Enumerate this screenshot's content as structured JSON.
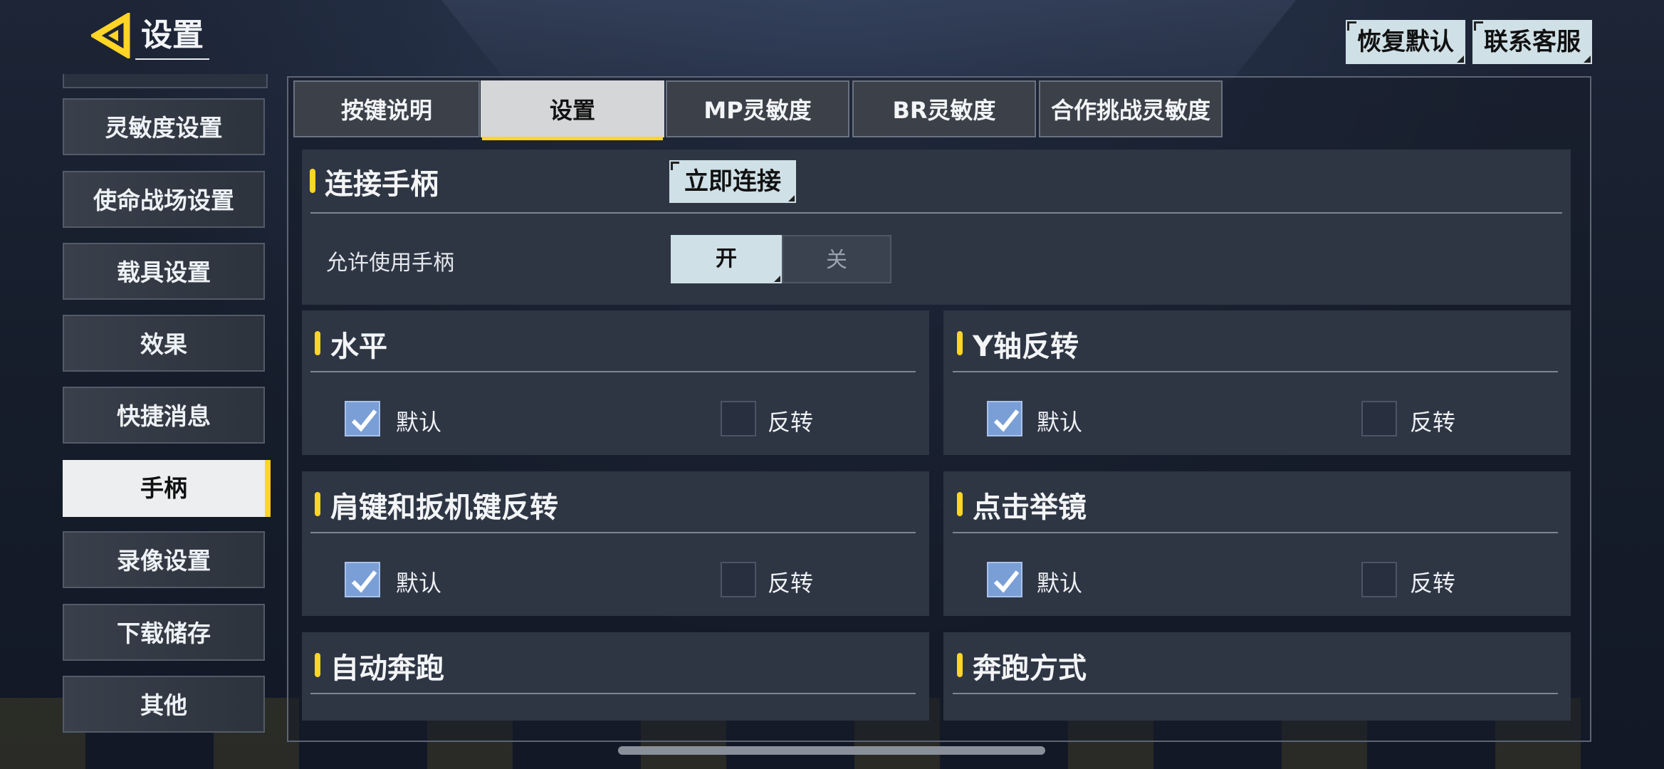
{
  "header": {
    "title": "设置",
    "restore_label": "恢复默认",
    "contact_label": "联系客服"
  },
  "sidebar": {
    "items": [
      {
        "label": "灵敏度设置"
      },
      {
        "label": "使命战场设置"
      },
      {
        "label": "载具设置"
      },
      {
        "label": "效果"
      },
      {
        "label": "快捷消息"
      },
      {
        "label": "手柄"
      },
      {
        "label": "录像设置"
      },
      {
        "label": "下载储存"
      },
      {
        "label": "其他"
      }
    ],
    "active": "手柄"
  },
  "tabs": {
    "items": [
      {
        "label": "按键说明"
      },
      {
        "label": "设置"
      },
      {
        "label": "MP灵敏度"
      },
      {
        "label": "BR灵敏度"
      },
      {
        "label": "合作挑战灵敏度"
      }
    ],
    "active": "设置"
  },
  "controller": {
    "title": "连接手柄",
    "connect_label": "立即连接",
    "allow_label": "允许使用手柄",
    "on_label": "开",
    "off_label": "关",
    "allow_value": "开"
  },
  "sections": {
    "horizontal": {
      "title": "水平",
      "default_label": "默认",
      "invert_label": "反转",
      "selected": "默认"
    },
    "y_invert": {
      "title": "Y轴反转",
      "default_label": "默认",
      "invert_label": "反转",
      "selected": "默认"
    },
    "bumper_invert": {
      "title": "肩键和扳机键反转",
      "default_label": "默认",
      "invert_label": "反转",
      "selected": "默认"
    },
    "tap_ads": {
      "title": "点击举镜",
      "default_label": "默认",
      "invert_label": "反转",
      "selected": "默认"
    },
    "auto_sprint": {
      "title": "自动奔跑"
    },
    "sprint_mode": {
      "title": "奔跑方式"
    }
  },
  "colors": {
    "accent": "#ffd526",
    "button_bg": "#cfe0e6",
    "checkbox_checked": "#7a9fd6",
    "panel_bg": "#2e3644"
  }
}
